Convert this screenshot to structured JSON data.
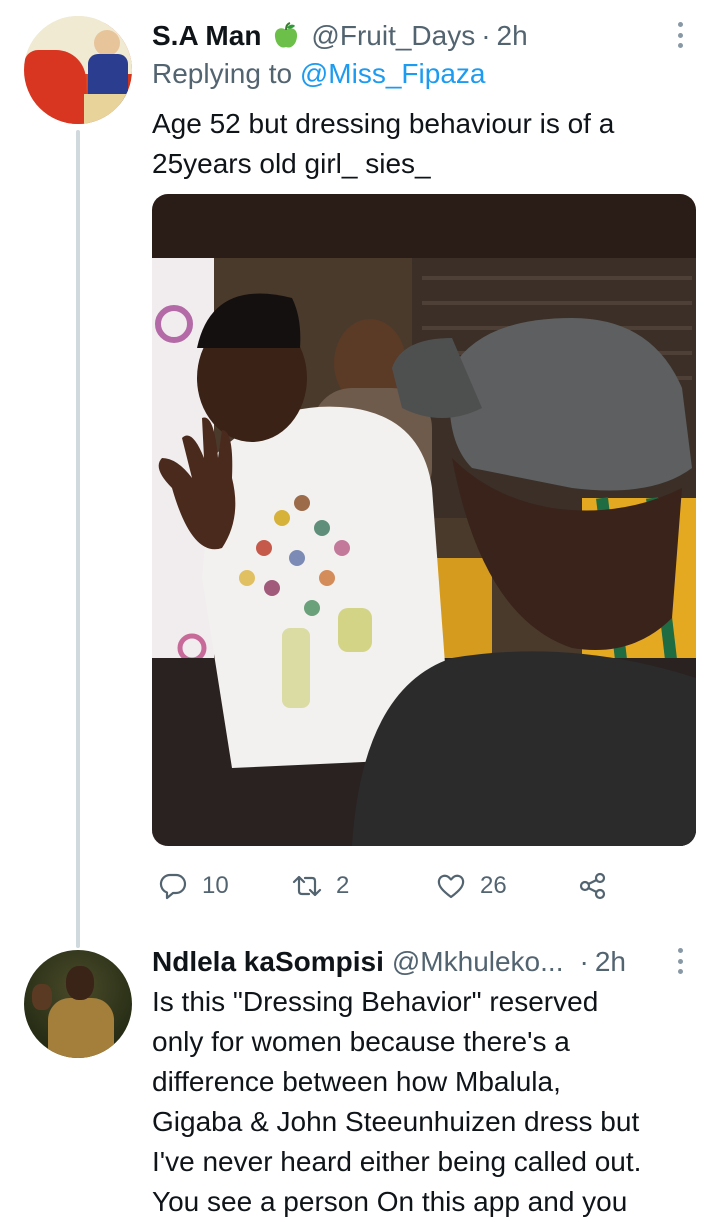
{
  "thread": {
    "colors": {
      "line": "#cfd9de",
      "link": "#1d9bf0",
      "secondary": "#536471"
    }
  },
  "tweet1": {
    "avatar_icon": "profile-photo",
    "name": "S.A Man",
    "name_emoji": "green-apple-icon",
    "handle": "@Fruit_Days",
    "time": "2h",
    "replying_prefix": "Replying to",
    "replying_to": "@Miss_Fipaza",
    "text_line1": "Age 52 but dressing behaviour is of a",
    "text_line2": "25years old girl_ sies_",
    "actions": {
      "replies": "10",
      "retweets": "2",
      "likes": "26"
    }
  },
  "tweet2": {
    "avatar_icon": "profile-photo",
    "name": "Ndlela kaSompisi",
    "handle": "@Mkhuleko...",
    "time": "2h",
    "text_lines": [
      "Is this \"Dressing Behavior\"  reserved",
      "only for women because there's a",
      "difference between how Mbalula,",
      "Gigaba & John Steeunhuizen dress but",
      "I've never heard either being called out.",
      "You see a person On this app and you"
    ]
  }
}
